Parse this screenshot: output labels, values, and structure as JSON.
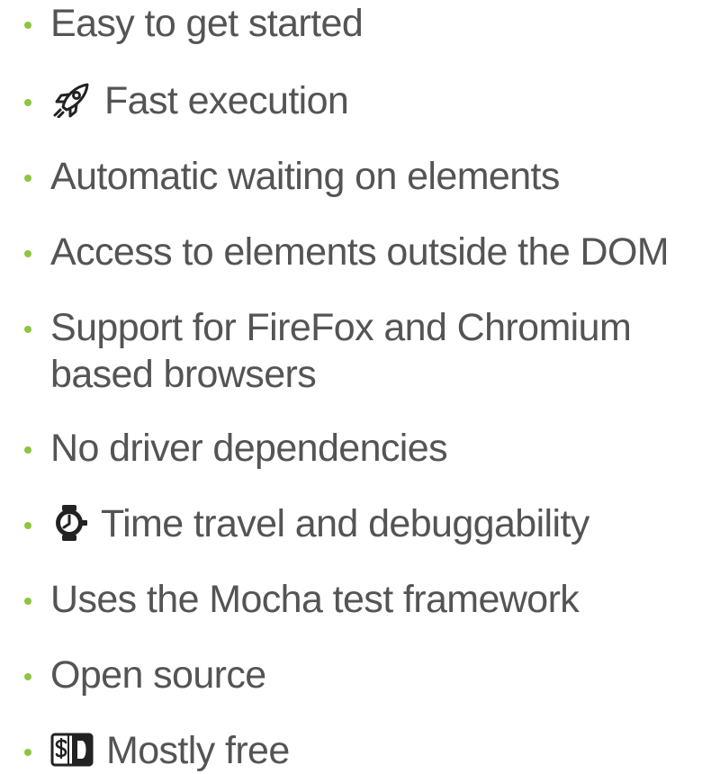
{
  "slide": {
    "bullets": [
      {
        "text": "Easy to get started"
      },
      {
        "text": "Fast execution",
        "icon": "rocket-icon"
      },
      {
        "text": "Automatic waiting on elements"
      },
      {
        "text": "Access to elements outside the DOM"
      },
      {
        "text": "Support for FireFox and Chromium based browsers"
      },
      {
        "text": "No driver dependencies"
      },
      {
        "text": "Time travel and debuggability",
        "icon": "stopwatch-icon"
      },
      {
        "text": "Uses the Mocha test framework"
      },
      {
        "text": "Open source"
      },
      {
        "text": "Mostly free",
        "icon": "money-icon"
      }
    ]
  },
  "colors": {
    "bullet": "#8cc63f",
    "text": "#545454"
  }
}
